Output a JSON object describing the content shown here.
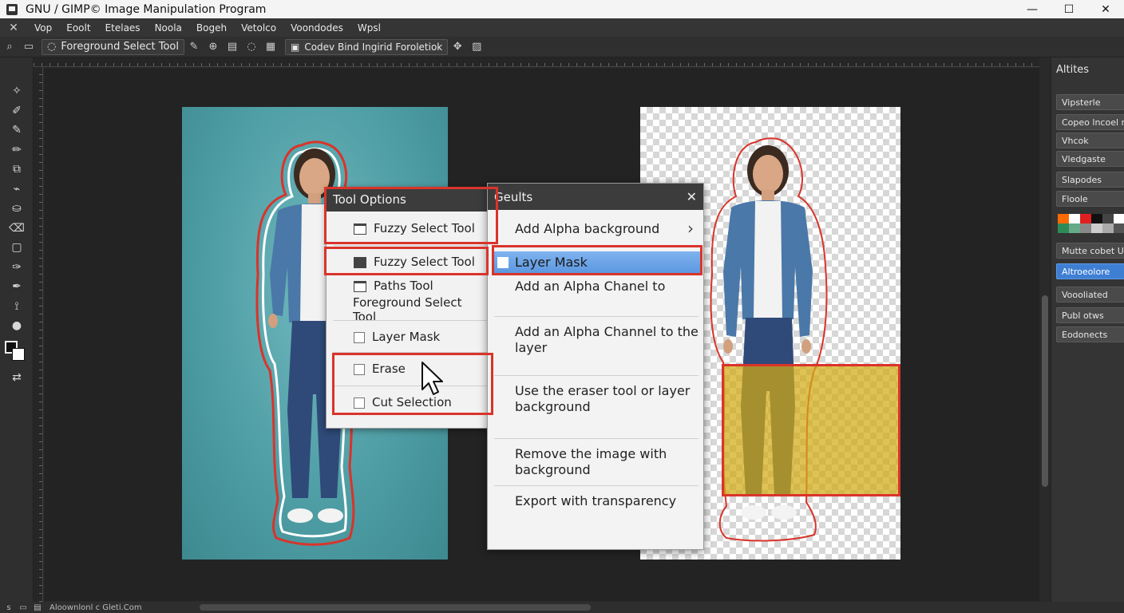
{
  "window": {
    "title": "GNU / GIMP© Image Manipulation Program",
    "minimize": "—",
    "maximize": "☐",
    "close": "✕"
  },
  "menubar": {
    "items": [
      "Vop",
      "Eoolt",
      "Etelaes",
      "Noola",
      "Bogeh",
      "Vetolco",
      "Voondodes",
      "Wpsl"
    ]
  },
  "options_bar": {
    "tool_name": "Foreground Select Tool",
    "mode_label": "Codev Bind Ingirid Foroletiok"
  },
  "canvas": {
    "tool_options": {
      "title": "Tool Options",
      "items": [
        "Fuzzy Select Tool",
        "Fuzzy Select Tool",
        "Paths Tool",
        "Foreground Select Tool",
        "Layer Mask",
        "Erase",
        "Cut Selection"
      ]
    },
    "results": {
      "title": "Geults",
      "close": "✕",
      "submenu_arrow": "›",
      "items": [
        "Add Alpha background",
        "Layer Mask",
        "Add an Alpha Chanel to",
        "Add an Alpha Channel to the layer",
        "Use the eraser tool or layer background",
        "Remove the image with background",
        "Export with transparency"
      ]
    }
  },
  "dock": {
    "title": "Altites",
    "buttons": [
      "Vipsterle",
      "Copeo lncoel rc",
      "Vhcok",
      "Vledgaste",
      "Slapodes",
      "Floole",
      "Mutte cobet Ur",
      "Altroeolore",
      "Voooliated",
      "Publ otws",
      "Eodonects"
    ],
    "swatch_colors": [
      "#ff6a00",
      "#fff",
      "#e02020",
      "#111",
      "#444",
      "#fff",
      "#2e8b57",
      "#66aa88",
      "#888",
      "#ccc",
      "#aaa",
      "#555"
    ]
  },
  "statusbar": {
    "text": "Aloownlonl c Gleti.Com"
  },
  "colors": {
    "highlight_red": "#d9342b",
    "selection_blue": "#5b97e0",
    "active_button": "#3f7fd3"
  }
}
